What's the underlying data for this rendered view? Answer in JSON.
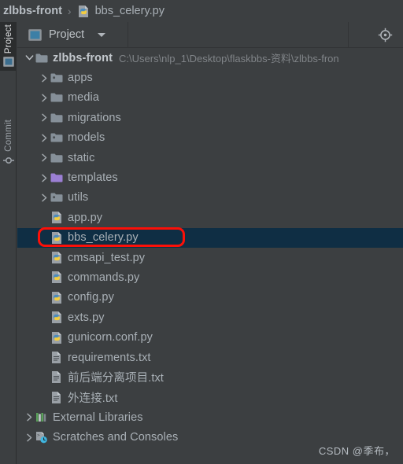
{
  "window": {
    "theme_bg": "#3c3f41",
    "text_color": "#a9b0b6",
    "selection_color": "#0f2e44",
    "annotation_color": "#fc1008"
  },
  "breadcrumb": {
    "root": "zlbbs-front",
    "separator": "›",
    "file": "bbs_celery.py",
    "file_icon": "python-file-icon"
  },
  "tool_rail": {
    "tabs": [
      {
        "label": "Project",
        "icon": "project-panel-icon",
        "active": true
      },
      {
        "label": "Commit",
        "icon": "commit-icon",
        "active": false
      }
    ]
  },
  "toolbar": {
    "title": "Project",
    "title_icon": "project-panel-icon",
    "dropdown_icon": "chevron-down-icon",
    "locate_icon": "select-opened-file-icon"
  },
  "tree": {
    "items": [
      {
        "label": "zlbbs-front",
        "path": "C:\\Users\\nlp_1\\Desktop\\flaskbbs-资料\\zlbbs-fron",
        "icon": "folder-module-icon",
        "arrow": "expanded",
        "indent": 0,
        "bold": true
      },
      {
        "label": "apps",
        "icon": "folder-package-icon",
        "arrow": "collapsed",
        "indent": 1
      },
      {
        "label": "media",
        "icon": "folder-icon",
        "arrow": "collapsed",
        "indent": 1
      },
      {
        "label": "migrations",
        "icon": "folder-icon",
        "arrow": "collapsed",
        "indent": 1
      },
      {
        "label": "models",
        "icon": "folder-package-icon",
        "arrow": "collapsed",
        "indent": 1
      },
      {
        "label": "static",
        "icon": "folder-icon",
        "arrow": "collapsed",
        "indent": 1
      },
      {
        "label": "templates",
        "icon": "folder-templates-icon",
        "arrow": "collapsed",
        "indent": 1
      },
      {
        "label": "utils",
        "icon": "folder-package-icon",
        "arrow": "collapsed",
        "indent": 1
      },
      {
        "label": "app.py",
        "icon": "python-file-icon",
        "arrow": "none",
        "indent": 1
      },
      {
        "label": "bbs_celery.py",
        "icon": "python-file-icon",
        "arrow": "none",
        "indent": 1,
        "selected": true,
        "annotated": true
      },
      {
        "label": "cmsapi_test.py",
        "icon": "python-file-icon",
        "arrow": "none",
        "indent": 1
      },
      {
        "label": "commands.py",
        "icon": "python-file-icon",
        "arrow": "none",
        "indent": 1
      },
      {
        "label": "config.py",
        "icon": "python-file-icon",
        "arrow": "none",
        "indent": 1
      },
      {
        "label": "exts.py",
        "icon": "python-file-icon",
        "arrow": "none",
        "indent": 1
      },
      {
        "label": "gunicorn.conf.py",
        "icon": "python-file-icon",
        "arrow": "none",
        "indent": 1
      },
      {
        "label": "requirements.txt",
        "icon": "text-file-icon",
        "arrow": "none",
        "indent": 1
      },
      {
        "label": "前后端分离项目.txt",
        "icon": "text-file-icon",
        "arrow": "none",
        "indent": 1
      },
      {
        "label": "外连接.txt",
        "icon": "text-file-icon",
        "arrow": "none",
        "indent": 1
      },
      {
        "label": "External Libraries",
        "icon": "external-libraries-icon",
        "arrow": "collapsed",
        "indent": 0
      },
      {
        "label": "Scratches and Consoles",
        "icon": "scratches-icon",
        "arrow": "collapsed",
        "indent": 0
      }
    ]
  },
  "watermark": {
    "text": "CSDN @季布，"
  }
}
